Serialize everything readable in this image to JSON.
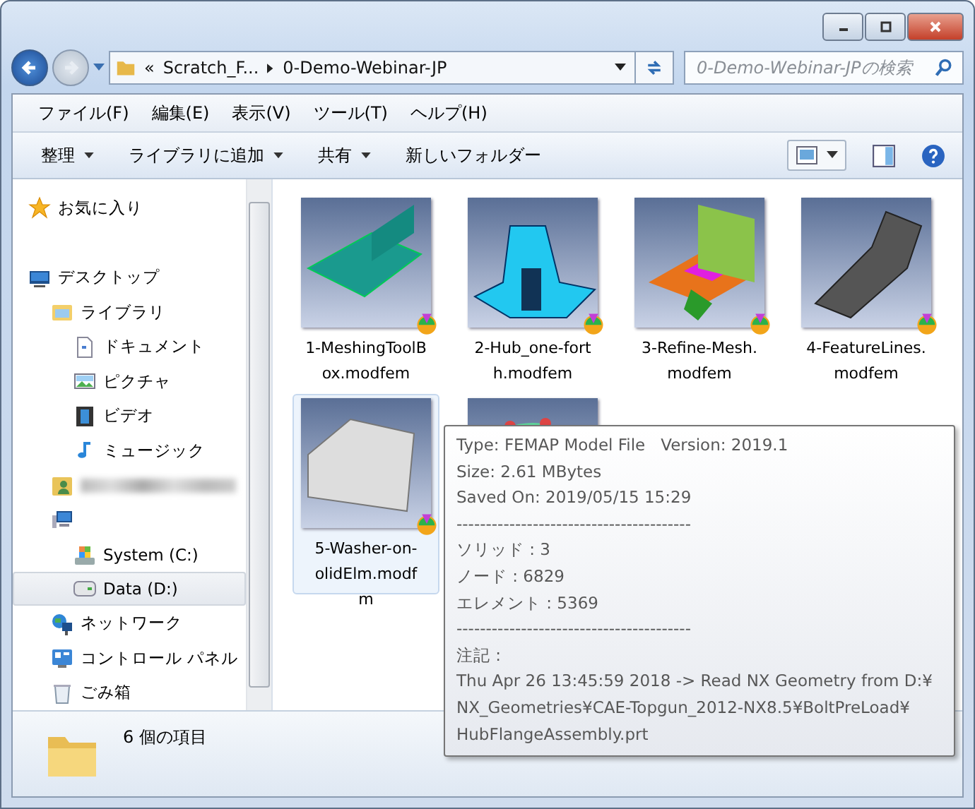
{
  "address": {
    "path": [
      "«",
      "Scratch_F...",
      "0-Demo-Webinar-JP"
    ]
  },
  "search": {
    "placeholder": "0-Demo-Webinar-JPの検索"
  },
  "menu": [
    "ファイル(F)",
    "編集(E)",
    "表示(V)",
    "ツール(T)",
    "ヘルプ(H)"
  ],
  "toolbar": [
    {
      "label": "整理",
      "dropdown": true
    },
    {
      "label": "ライブラリに追加",
      "dropdown": true
    },
    {
      "label": "共有",
      "dropdown": true
    },
    {
      "label": "新しいフォルダー",
      "dropdown": false
    }
  ],
  "nav": [
    {
      "kind": "star",
      "label": "お気に入り",
      "selected": false
    },
    {
      "kind": "desktop",
      "label": "デスクトップ",
      "selected": false,
      "children": [
        {
          "kind": "library",
          "label": "ライブラリ",
          "selected": false,
          "children": [
            {
              "kind": "document",
              "label": "ドキュメント",
              "selected": false
            },
            {
              "kind": "picture",
              "label": "ピクチャ",
              "selected": false
            },
            {
              "kind": "video",
              "label": "ビデオ",
              "selected": false
            },
            {
              "kind": "music",
              "label": "ミュージック",
              "selected": false
            }
          ]
        },
        {
          "kind": "user",
          "redacted": true,
          "selected": false
        },
        {
          "kind": "computer",
          "selected": false,
          "children": [
            {
              "kind": "drivec",
              "label": "System (C:)",
              "selected": false
            },
            {
              "kind": "drive",
              "label": "Data (D:)",
              "selected": true
            }
          ]
        },
        {
          "kind": "network",
          "label": "ネットワーク",
          "selected": false
        },
        {
          "kind": "control",
          "label": "コントロール パネル",
          "selected": false
        },
        {
          "kind": "recycle",
          "label": "ごみ箱",
          "selected": false
        }
      ]
    }
  ],
  "files": [
    {
      "kind": "plate",
      "lines": [
        "1-MeshingToolB",
        "ox.modfem"
      ],
      "selected": false
    },
    {
      "kind": "hub",
      "lines": [
        "2-Hub_one-fort",
        "h.modfem"
      ],
      "selected": false
    },
    {
      "kind": "grid",
      "lines": [
        "3-Refine-Mesh.",
        "modfem"
      ],
      "selected": false
    },
    {
      "kind": "lines",
      "lines": [
        "4-FeatureLines.",
        "modfem"
      ],
      "selected": false
    },
    {
      "kind": "washer",
      "lines": [
        "5-Washer-on-",
        "olidElm.modf",
        "m"
      ],
      "selected": true
    },
    {
      "kind": "assembly",
      "selected": false
    }
  ],
  "tooltip": {
    "lines": [
      "Type: FEMAP Model File   Version: 2019.1",
      "Size: 2.61 MBytes",
      "Saved On: 2019/05/15 15:29",
      "----------------------------------------",
      "ソリッド : 3",
      "ノード : 6829",
      "エレメント : 5369",
      "----------------------------------------",
      "注記 :",
      "Thu Apr 26 13:45:59 2018 -> Read NX Geometry from D:¥",
      "NX_Geometries¥CAE-Topgun_2012-NX8.5¥BoltPreLoad¥",
      "HubFlangeAssembly.prt"
    ]
  },
  "status_bar": {
    "count": "6 個の項目"
  }
}
